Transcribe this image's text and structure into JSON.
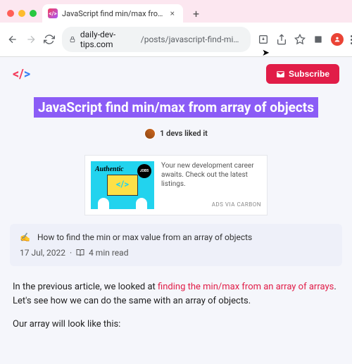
{
  "browser": {
    "tab_title": "JavaScript find min/max from a...",
    "url_domain": "daily-dev-tips.com",
    "url_path": "/posts/javascript-find-min-max-..."
  },
  "header": {
    "subscribe_label": "Subscribe"
  },
  "hero": {
    "title": "JavaScript find min/max from array of objects",
    "likes_text": "1 devs liked it"
  },
  "ad": {
    "brand": "Authentic",
    "badge": "JOBS",
    "copy": "Your new development career awaits. Check out the latest listings.",
    "attribution": "ADS VIA CARBON"
  },
  "meta": {
    "emoji": "✍️",
    "summary": "How to find the min or max value from an array of objects",
    "date": "17 Jul, 2022",
    "separator": "·",
    "read_time": "4 min read"
  },
  "body": {
    "p1_a": "In the previous article, we looked at ",
    "p1_link": "finding the min/max from an array of arrays",
    "p1_b": ". Let's see how we can do the same with an array of objects.",
    "p2": "Our array will look like this:"
  }
}
